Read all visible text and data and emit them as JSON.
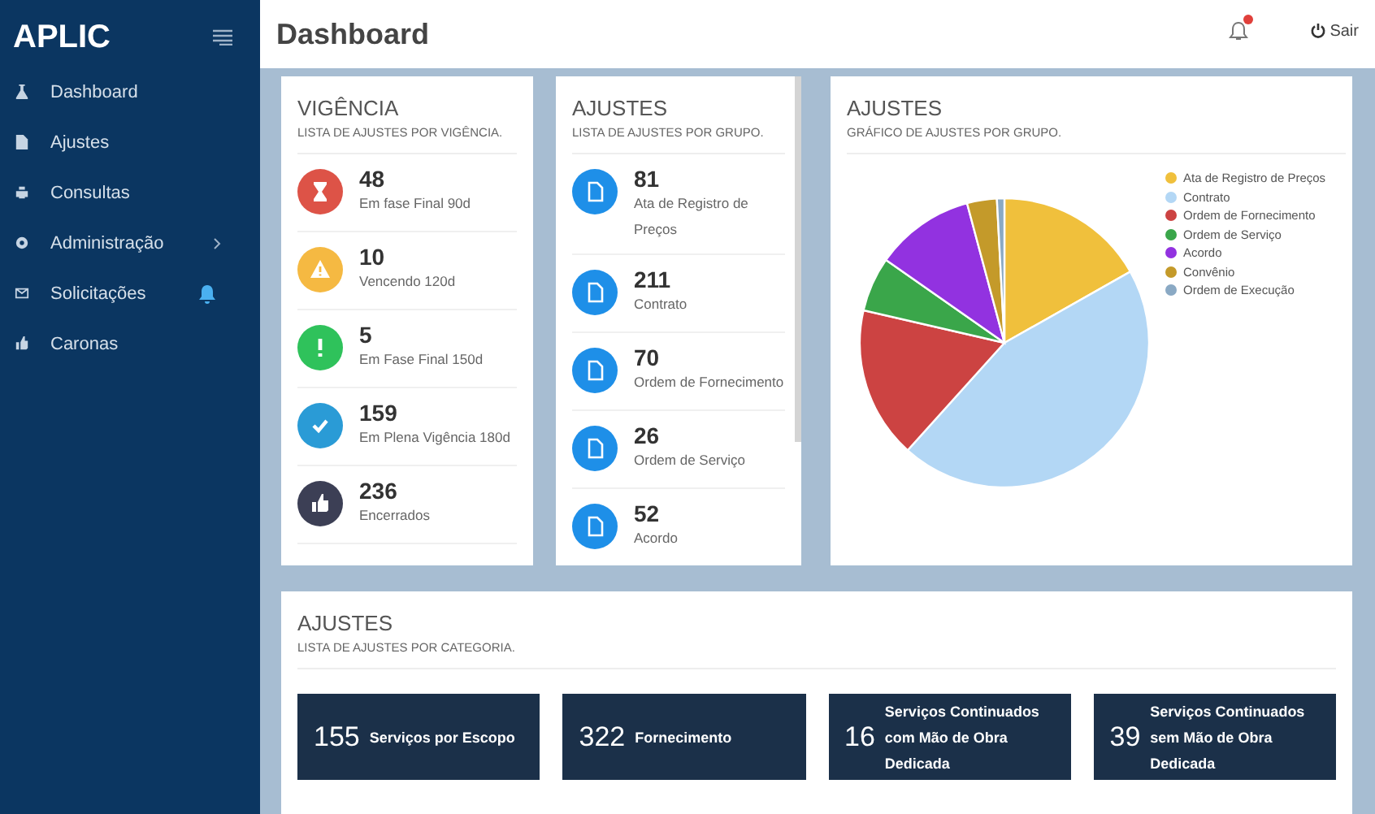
{
  "sidebar": {
    "brand": "APLIC",
    "items": [
      {
        "label": "Dashboard",
        "kind": "flask",
        "submenu": false,
        "alert": false
      },
      {
        "label": "Ajustes",
        "kind": "file",
        "submenu": false,
        "alert": false
      },
      {
        "label": "Consultas",
        "kind": "printer",
        "submenu": false,
        "alert": false
      },
      {
        "label": "Administração",
        "kind": "gear",
        "submenu": true,
        "alert": false
      },
      {
        "label": "Solicitações",
        "kind": "envelope",
        "submenu": false,
        "alert": true
      },
      {
        "label": "Caronas",
        "kind": "thumb",
        "submenu": false,
        "alert": false
      }
    ]
  },
  "header": {
    "title": "Dashboard",
    "notification": true,
    "logout": "Sair"
  },
  "vigencia": {
    "title": "VIGÊNCIA",
    "subtitle": "LISTA DE AJUSTES POR VIGÊNCIA.",
    "items": [
      {
        "count": "48",
        "label": "Em fase Final 90d",
        "kind": "hourglass",
        "color": "#dd5347"
      },
      {
        "count": "10",
        "label": "Vencendo 120d",
        "kind": "warning",
        "color": "#f5b942"
      },
      {
        "count": "5",
        "label": "Em Fase Final 150d",
        "kind": "exclamation",
        "color": "#2fc25b"
      },
      {
        "count": "159",
        "label": "Em Plena Vigência 180d",
        "kind": "check",
        "color": "#2a9bd6"
      },
      {
        "count": "236",
        "label": "Encerrados",
        "kind": "thumb",
        "color": "#3c3f55"
      }
    ]
  },
  "grupos": {
    "title": "AJUSTES",
    "subtitle": "LISTA DE AJUSTES POR GRUPO.",
    "items": [
      {
        "count": "81",
        "label": "Ata de Registro de Preços"
      },
      {
        "count": "211",
        "label": "Contrato"
      },
      {
        "count": "70",
        "label": "Ordem de Fornecimento"
      },
      {
        "count": "26",
        "label": "Ordem de Serviço"
      },
      {
        "count": "52",
        "label": "Acordo"
      }
    ]
  },
  "grafico": {
    "title": "AJUSTES",
    "subtitle": "GRÁFICO DE AJUSTES POR GRUPO.",
    "legend": [
      {
        "label": "Ata de Registro de Preços",
        "color": "#f0c03c"
      },
      {
        "label": "Contrato",
        "color": "#b3d7f5"
      },
      {
        "label": "Ordem de Fornecimento",
        "color": "#cc4342"
      },
      {
        "label": "Ordem de Serviço",
        "color": "#3aa64a"
      },
      {
        "label": "Acordo",
        "color": "#9232e0"
      },
      {
        "label": "Convênio",
        "color": "#c49a2a"
      },
      {
        "label": "Ordem de Execução",
        "color": "#8aa9c4"
      }
    ]
  },
  "categorias": {
    "title": "AJUSTES",
    "subtitle": "LISTA DE AJUSTES POR CATEGORIA.",
    "items": [
      {
        "count": "155",
        "label": "Serviços por Escopo"
      },
      {
        "count": "322",
        "label": "Fornecimento"
      },
      {
        "count": "16",
        "label": "Serviços Continuados com Mão de Obra Dedicada"
      },
      {
        "count": "39",
        "label": "Serviços Continuados sem Mão de Obra Dedicada"
      }
    ]
  }
}
